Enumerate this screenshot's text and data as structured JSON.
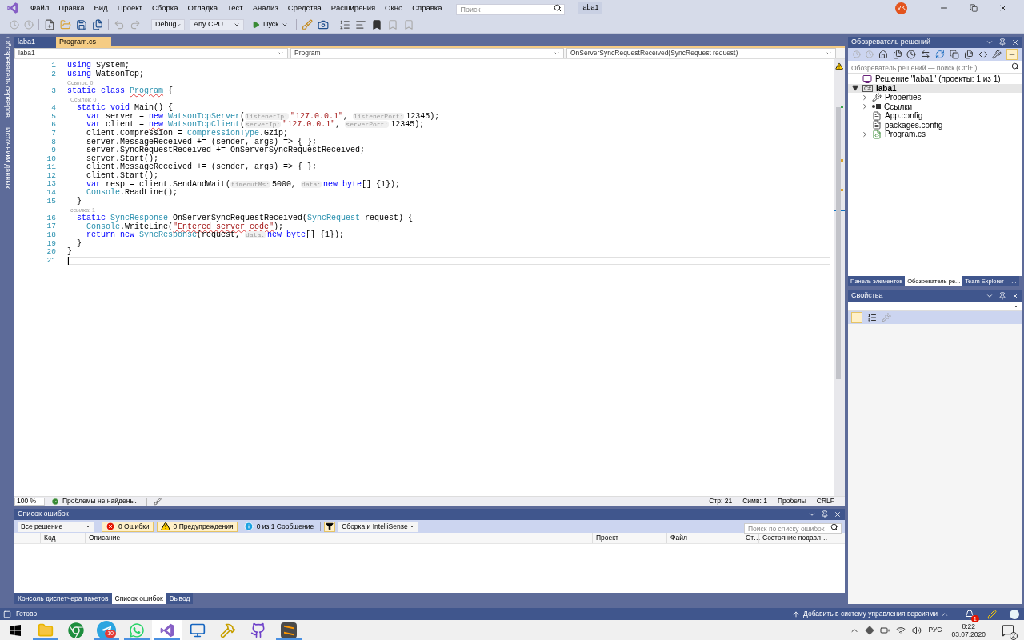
{
  "title_bar": {
    "menu": [
      "Файл",
      "Правка",
      "Вид",
      "Проект",
      "Сборка",
      "Отладка",
      "Тест",
      "Анализ",
      "Средства",
      "Расширения",
      "Окно",
      "Справка"
    ],
    "search": {
      "placeholder": "Поиск"
    },
    "solution_name": "laba1",
    "user_initials": "VK"
  },
  "toolbar": {
    "configuration": "Debug",
    "platform": "Any CPU",
    "start": "Пуск"
  },
  "side_tabs": [
    "Обозреватель серверов",
    "Источники данных"
  ],
  "editor": {
    "tabs": [
      {
        "label": "laba1",
        "selected": false
      },
      {
        "label": "Program.cs",
        "selected": true
      }
    ],
    "nav": [
      "laba1",
      "Program",
      "OnServerSyncRequestReceived(SyncRequest request)"
    ],
    "lines": [
      {
        "kind": "code",
        "number": "1",
        "current": false,
        "tokens": [
          {
            "kind": "kw",
            "s": "using"
          },
          {
            "kind": "plain",
            "s": " System;"
          }
        ]
      },
      {
        "kind": "code",
        "number": "2",
        "current": false,
        "tokens": [
          {
            "kind": "kw",
            "s": "using"
          },
          {
            "kind": "plain",
            "s": " WatsonTcp;"
          }
        ]
      },
      {
        "kind": "lens",
        "text": "Ссылок: 0"
      },
      {
        "kind": "code",
        "number": "3",
        "current": false,
        "tokens": [
          {
            "kind": "kw",
            "s": "static class "
          },
          {
            "kind": "type",
            "s": "Program",
            "squiggle": true
          },
          {
            "kind": "plain",
            "s": " {"
          }
        ]
      },
      {
        "kind": "lens",
        "text": "  Ссылок: 0"
      },
      {
        "kind": "code",
        "number": "4",
        "current": false,
        "tokens": [
          {
            "kind": "kw",
            "s": "  static void"
          },
          {
            "kind": "plain",
            "s": " Main() {"
          }
        ]
      },
      {
        "kind": "code",
        "number": "5",
        "current": false,
        "tokens": [
          {
            "kind": "kw",
            "s": "    var"
          },
          {
            "kind": "plain",
            "s": " server = "
          },
          {
            "kind": "kw",
            "s": "new "
          },
          {
            "kind": "type",
            "s": "WatsonTcpServer"
          },
          {
            "kind": "plain",
            "s": "("
          },
          {
            "kind": "hint",
            "s": "listenerIp:"
          },
          {
            "kind": "str",
            "s": "\"127.0.0.1\""
          },
          {
            "kind": "plain",
            "s": ", "
          },
          {
            "kind": "hint",
            "s": "listenerPort:"
          },
          {
            "kind": "plain",
            "s": "12345);"
          }
        ]
      },
      {
        "kind": "code",
        "number": "6",
        "current": false,
        "tokens": [
          {
            "kind": "kw",
            "s": "    var"
          },
          {
            "kind": "plain",
            "s": " client = "
          },
          {
            "kind": "kw",
            "s": "new",
            "squiggle": true
          },
          {
            "kind": "type",
            "s": " WatsonTcpClient"
          },
          {
            "kind": "plain",
            "s": "("
          },
          {
            "kind": "hint",
            "s": "serverIp:"
          },
          {
            "kind": "str",
            "s": "\"127.0.0.1\""
          },
          {
            "kind": "plain",
            "s": ", "
          },
          {
            "kind": "hint",
            "s": "serverPort:"
          },
          {
            "kind": "plain",
            "s": "12345);"
          }
        ]
      },
      {
        "kind": "code",
        "number": "7",
        "current": false,
        "tokens": [
          {
            "kind": "plain",
            "s": "    client.Compression = "
          },
          {
            "kind": "type",
            "s": "CompressionType"
          },
          {
            "kind": "plain",
            "s": ".Gzip;"
          }
        ]
      },
      {
        "kind": "code",
        "number": "8",
        "current": false,
        "tokens": [
          {
            "kind": "plain",
            "s": "    server.MessageReceived += (sender, args) => { };"
          }
        ]
      },
      {
        "kind": "code",
        "number": "9",
        "current": false,
        "tokens": [
          {
            "kind": "plain",
            "s": "    server.SyncRequestReceived += OnServerSyncRequestReceived;"
          }
        ]
      },
      {
        "kind": "code",
        "number": "10",
        "current": false,
        "tokens": [
          {
            "kind": "plain",
            "s": "    server.Start();"
          }
        ]
      },
      {
        "kind": "code",
        "number": "11",
        "current": false,
        "tokens": [
          {
            "kind": "plain",
            "s": "    client.MessageReceived += (sender, args) => { };"
          }
        ]
      },
      {
        "kind": "code",
        "number": "12",
        "current": false,
        "tokens": [
          {
            "kind": "plain",
            "s": "    client.Start();"
          }
        ]
      },
      {
        "kind": "code",
        "number": "13",
        "current": false,
        "tokens": [
          {
            "kind": "kw",
            "s": "    var"
          },
          {
            "kind": "plain",
            "s": " resp = client.SendAndWait("
          },
          {
            "kind": "hint",
            "s": "timeoutMs:"
          },
          {
            "kind": "plain",
            "s": "5000, "
          },
          {
            "kind": "hint",
            "s": "data:"
          },
          {
            "kind": "kw",
            "s": "new byte"
          },
          {
            "kind": "plain",
            "s": "[] {1});"
          }
        ]
      },
      {
        "kind": "code",
        "number": "14",
        "current": false,
        "tokens": [
          {
            "kind": "type",
            "s": "    Console"
          },
          {
            "kind": "plain",
            "s": ".ReadLine();"
          }
        ]
      },
      {
        "kind": "code",
        "number": "15",
        "current": false,
        "tokens": [
          {
            "kind": "plain",
            "s": "  }"
          }
        ]
      },
      {
        "kind": "lens",
        "text": "  ссылка: 1"
      },
      {
        "kind": "code",
        "number": "16",
        "current": false,
        "tokens": [
          {
            "kind": "kw",
            "s": "  static "
          },
          {
            "kind": "type",
            "s": "SyncResponse"
          },
          {
            "kind": "plain",
            "s": " OnServerSyncRequestReceived("
          },
          {
            "kind": "type",
            "s": "SyncRequest"
          },
          {
            "kind": "plain",
            "s": " request) {"
          }
        ]
      },
      {
        "kind": "code",
        "number": "17",
        "current": false,
        "tokens": [
          {
            "kind": "type",
            "s": "    Console"
          },
          {
            "kind": "plain",
            "s": ".WriteLine("
          },
          {
            "kind": "str",
            "s": "\"Entered server code\"",
            "squiggle": true
          },
          {
            "kind": "plain",
            "s": ");"
          }
        ]
      },
      {
        "kind": "code",
        "number": "18",
        "current": false,
        "tokens": [
          {
            "kind": "kw",
            "s": "    return new "
          },
          {
            "kind": "type",
            "s": "SyncResponse"
          },
          {
            "kind": "plain",
            "s": "(request, "
          },
          {
            "kind": "hint",
            "s": "data:"
          },
          {
            "kind": "kw",
            "s": "new byte"
          },
          {
            "kind": "plain",
            "s": "[] {1});"
          }
        ]
      },
      {
        "kind": "code",
        "number": "19",
        "current": false,
        "tokens": [
          {
            "kind": "plain",
            "s": "  }"
          }
        ]
      },
      {
        "kind": "code",
        "number": "20",
        "current": false,
        "tokens": [
          {
            "kind": "plain",
            "s": "}"
          }
        ]
      },
      {
        "kind": "code",
        "number": "21",
        "current": true
      }
    ],
    "zoom": "100 %",
    "issues": "Проблемы не найдены.",
    "position": [
      "Стр: 21",
      "Симв: 1",
      "Пробелы",
      "CRLF"
    ]
  },
  "error_list": {
    "title": "Список ошибок",
    "scope": "Все решение",
    "filters": [
      {
        "kind": "error",
        "label": "0 Ошибки",
        "on": true
      },
      {
        "kind": "warning",
        "label": "0 Предупреждения",
        "on": true
      },
      {
        "kind": "info",
        "label": "0 из 1 Сообщение",
        "on": false
      }
    ],
    "source": "Сборка и IntelliSense",
    "search": {
      "placeholder": "Поиск по списку ошибок"
    },
    "columns": [
      "Код",
      "Описание",
      "Проект",
      "Файл",
      "Ст…",
      "Состояние подавл…"
    ]
  },
  "bottom_tabs": [
    {
      "label": "Консоль диспетчера пакетов",
      "selected": false
    },
    {
      "label": "Список ошибок",
      "selected": true
    },
    {
      "label": "Вывод",
      "selected": false
    }
  ],
  "solution_explorer": {
    "title": "Обозреватель решений",
    "search": {
      "placeholder": "Обозреватель решений — поиск (Ctrl+;)"
    },
    "tree": [
      {
        "kind": "solution",
        "label": "Решение \"laba1\" (проекты: 1 из 1)",
        "selected": false,
        "children": [
          {
            "kind": "project",
            "badge": "C#",
            "label": "laba1",
            "expanded": true,
            "selected": true,
            "children": [
              {
                "kind": "properties",
                "label": "Properties",
                "expanded": false,
                "selected": false
              },
              {
                "kind": "references",
                "label": "Ссылки",
                "expanded": false,
                "selected": false
              },
              {
                "kind": "config",
                "label": "App.config",
                "selected": false
              },
              {
                "kind": "config",
                "label": "packages.config",
                "selected": false
              },
              {
                "kind": "csharp",
                "label": "Program.cs",
                "expanded": false,
                "selected": false
              }
            ]
          }
        ]
      }
    ]
  },
  "right_tabs": [
    {
      "label": "Панель элементов",
      "selected": false
    },
    {
      "label": "Обозреватель ре...",
      "selected": true
    },
    {
      "label": "Team Explorer —...",
      "selected": false
    }
  ],
  "properties": {
    "title": "Свойства"
  },
  "status_bar": {
    "text": "Готово",
    "source_control": "Добавить в систему управления версиями",
    "notifications": "1"
  },
  "taskbar": {
    "apps": [
      {
        "kind": "start",
        "running": false,
        "selected": false
      },
      {
        "kind": "folder",
        "running": true,
        "selected": false
      },
      {
        "kind": "browser",
        "running": false,
        "selected": false
      },
      {
        "kind": "telegram",
        "running": true,
        "selected": false,
        "badge": "10"
      },
      {
        "kind": "whatsapp",
        "running": true,
        "selected": false
      },
      {
        "kind": "vs",
        "running": true,
        "selected": true
      },
      {
        "kind": "remote",
        "running": false,
        "selected": false
      },
      {
        "kind": "tool",
        "running": false,
        "selected": false
      },
      {
        "kind": "github",
        "running": false,
        "selected": false
      },
      {
        "kind": "sublime",
        "running": true,
        "selected": false
      }
    ],
    "language": "РУС",
    "time": "8:22",
    "date": "03.07.2020",
    "notifications": "2"
  }
}
